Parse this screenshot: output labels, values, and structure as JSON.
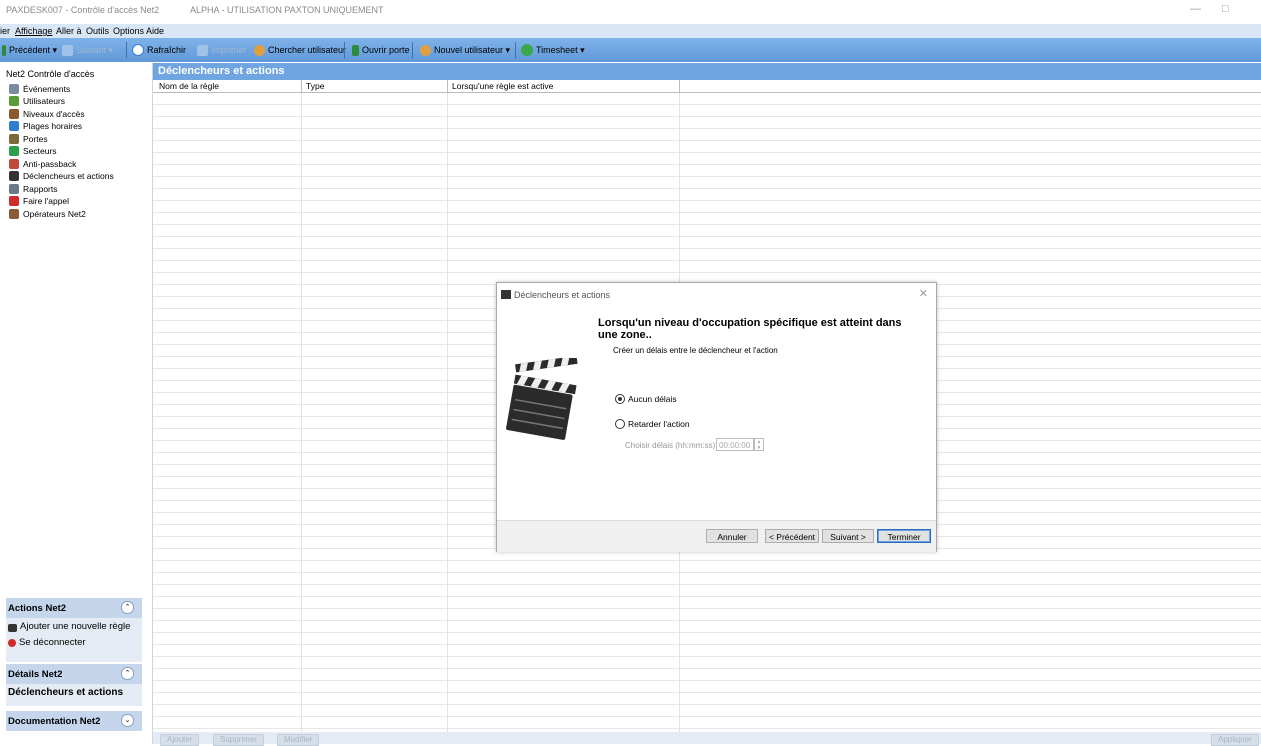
{
  "window": {
    "title": "PAXDESK007 - Contrôle d'accès Net2",
    "subtitle": "ALPHA - UTILISATION PAXTON UNIQUEMENT",
    "min": "—",
    "max": "□"
  },
  "menu": [
    "ier",
    "Affichage",
    "Aller à",
    "Outils",
    "Options",
    "Aide"
  ],
  "toolbar": {
    "back": "Précédent ▾",
    "forward": "Suivant ▾",
    "refresh": "Rafraîchir",
    "print": "Imprimer",
    "find_user": "Chercher utilisateur",
    "open_door": "Ouvrir porte",
    "new_user": "Nouvel utilisateur ▾",
    "timesheet": "Timesheet ▾"
  },
  "tree": {
    "root": "Net2 Contrôle d'accès",
    "items": [
      {
        "label": "Événements",
        "icon": "events-icon",
        "color": "#7a8aa0"
      },
      {
        "label": "Utilisateurs",
        "icon": "users-icon",
        "color": "#5a9c3a"
      },
      {
        "label": "Niveaux d'accès",
        "icon": "access-levels-icon",
        "color": "#8a5a2a"
      },
      {
        "label": "Plages horaires",
        "icon": "clock-icon",
        "color": "#2f7fd0"
      },
      {
        "label": "Portes",
        "icon": "door-icon",
        "color": "#7a6a3a"
      },
      {
        "label": "Secteurs",
        "icon": "sectors-icon",
        "color": "#2aa04a"
      },
      {
        "label": "Anti-passback",
        "icon": "anti-passback-icon",
        "color": "#c04a3a"
      },
      {
        "label": "Déclencheurs et actions",
        "icon": "clapperboard-icon",
        "color": "#333333"
      },
      {
        "label": "Rapports",
        "icon": "reports-icon",
        "color": "#6a7a8a"
      },
      {
        "label": "Faire l'appel",
        "icon": "roll-call-icon",
        "color": "#d02a2a"
      },
      {
        "label": "Opérateurs Net2",
        "icon": "operators-icon",
        "color": "#8a5a3a"
      }
    ]
  },
  "actions_panel": {
    "title": "Actions Net2",
    "chevron": "⌃",
    "items": [
      "Ajouter une nouvelle règle",
      "Se déconnecter"
    ]
  },
  "details_panel": {
    "title": "Détails Net2",
    "chevron": "⌃",
    "value": "Déclencheurs et actions"
  },
  "doc_panel": {
    "title": "Documentation Net2",
    "chevron": "⌄"
  },
  "main": {
    "title": "Déclencheurs et actions",
    "columns": [
      "Nom de la règle",
      "Type",
      "Lorsqu'une règle est active"
    ]
  },
  "bottom_buttons": [
    "Ajouter",
    "Supprimer",
    "Modifier",
    "Appliquer"
  ],
  "dialog": {
    "title": "Déclencheurs et actions",
    "close": "✕",
    "heading": "Lorsqu'un niveau d'occupation spécifique est atteint dans une zone..",
    "subheading": "Créer un délais entre le déclencheur et l'action",
    "option_none": "Aucun délais",
    "option_delay": "Retarder l'action",
    "delay_label": "Choisir délais (hh:mm:ss)",
    "delay_value": "00:00:00",
    "buttons": {
      "cancel": "Annuler",
      "previous": "< Précédent",
      "next": "Suivant >",
      "finish": "Terminer"
    }
  }
}
